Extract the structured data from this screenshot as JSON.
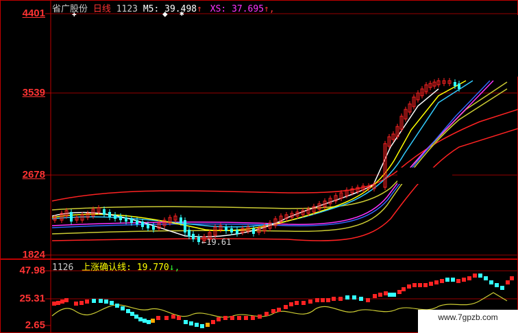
{
  "header": {
    "stock_name": "省广股份",
    "period": "日线",
    "count": "1123",
    "ma5_label": "M5:",
    "ma5_value": "39.498",
    "ma5_arrow": "↑",
    "xs_label": "XS:",
    "xs_value": "37.695",
    "xs_arrow": "↑,"
  },
  "main_axis": {
    "labels": [
      "4401",
      "3539",
      "2678",
      "1824"
    ]
  },
  "low_annotation": "←19.61",
  "subchart": {
    "count": "1126",
    "indicator_label": "上涨确认线:",
    "indicator_value": "19.770",
    "indicator_arrow": "↓,",
    "axis_labels": [
      "47.98",
      "25.31",
      "2.65"
    ]
  },
  "watermark": "www.7gpzb.com",
  "colors": {
    "up": "#ff2222",
    "down": "#33ffff",
    "ma_white": "#ffffff",
    "ma_yellow": "#ffff00",
    "ma_magenta": "#ff33ff",
    "ma_cyan": "#33ccff",
    "band_red": "#ff2222",
    "band_yellow": "#cccc33",
    "grid_red": "#aa0000"
  }
}
